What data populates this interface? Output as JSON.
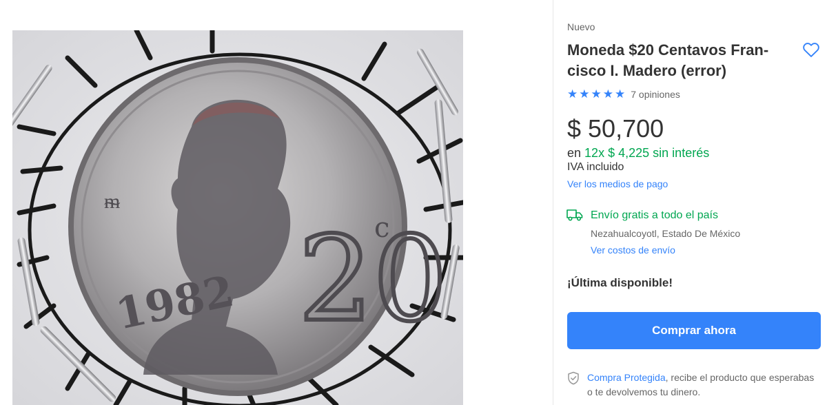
{
  "product": {
    "condition": "Nuevo",
    "title": "Moneda $20 Centavos Fran- cisco I. Madero (error)",
    "rating": {
      "stars": 5,
      "reviews_label": "7 opiniones"
    },
    "price": {
      "currency": "$",
      "amount": "50,700"
    },
    "installments": {
      "prefix": "en",
      "count": "12x",
      "amount": "$ 4,225",
      "suffix": "sin interés"
    },
    "tax_note": "IVA incluido",
    "payment_methods_link": "Ver los medios de pago",
    "shipping": {
      "label": "Envío gratis a todo el país",
      "location": "Nezahualcoyotl, Estado De México",
      "costs_link": "Ver costos de envío"
    },
    "stock": "¡Última disponible!",
    "buy_button": "Comprar ahora",
    "protection": {
      "highlight": "Compra Protegida",
      "text": ", recibe el producto que esperabas o te devolvemos tu dinero."
    }
  },
  "photo": {
    "coin_year": "1982",
    "coin_value": "20",
    "coin_unit": "c"
  },
  "icons": {
    "favorite": "heart-outline-icon",
    "shipping": "truck-icon",
    "protection": "shield-check-icon"
  },
  "colors": {
    "accent": "#3483fa",
    "success": "#00a650",
    "text": "#333333",
    "muted": "#666666"
  }
}
